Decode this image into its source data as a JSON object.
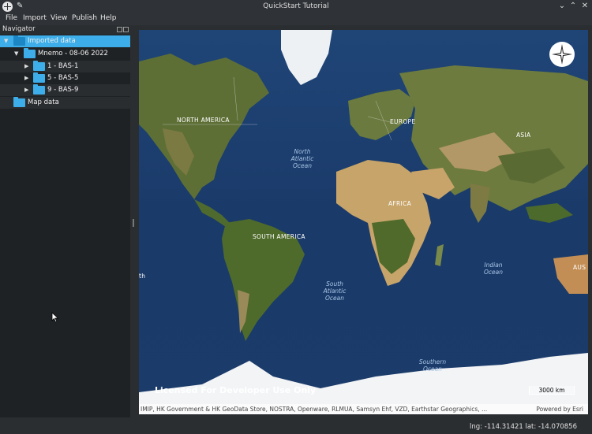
{
  "window": {
    "title": "QuickStart Tutorial"
  },
  "menu": [
    "File",
    "Import",
    "View",
    "Publish",
    "Help"
  ],
  "navigator": {
    "title": "Navigator",
    "items": [
      {
        "label": "Imported data",
        "icon": "folder-icon",
        "expanded": true,
        "selected": true
      },
      {
        "label": "Mnemo - 08-06 2022",
        "icon": "folder-icon",
        "expanded": true
      },
      {
        "label": "1 - BAS-1",
        "icon": "folder-icon",
        "expanded": false
      },
      {
        "label": "5 - BAS-5",
        "icon": "folder-icon",
        "expanded": false
      },
      {
        "label": "9 - BAS-9",
        "icon": "folder-icon",
        "expanded": false
      },
      {
        "label": "Map data",
        "icon": "globe-folder-icon"
      }
    ]
  },
  "map": {
    "continents": [
      "NORTH AMERICA",
      "EUROPE",
      "ASIA",
      "AFRICA",
      "SOUTH AMERICA",
      "AUS"
    ],
    "oceans": [
      "North Atlantic Ocean",
      "South Atlantic Ocean",
      "Indian Ocean",
      "Southern Ocean"
    ],
    "watermark": "Licensed For Developer Use Only",
    "scale": "3000 km",
    "attribution": "IMIP, HK Government & HK GeoData Store, NOSTRA, Openware, RLMUA, Samsyn Ehf, VZD, Earthstar Geographics, ...",
    "powered_by": "Powered by Esri",
    "partial_label": "th"
  },
  "status": {
    "coords": "lng: -114.31421 lat: -14.070856"
  },
  "colors": {
    "accent": "#3daee9",
    "ocean": "#1c3a66",
    "land": "#6b7a3e",
    "desert": "#c8a66a",
    "ice": "#f2f4f6"
  }
}
